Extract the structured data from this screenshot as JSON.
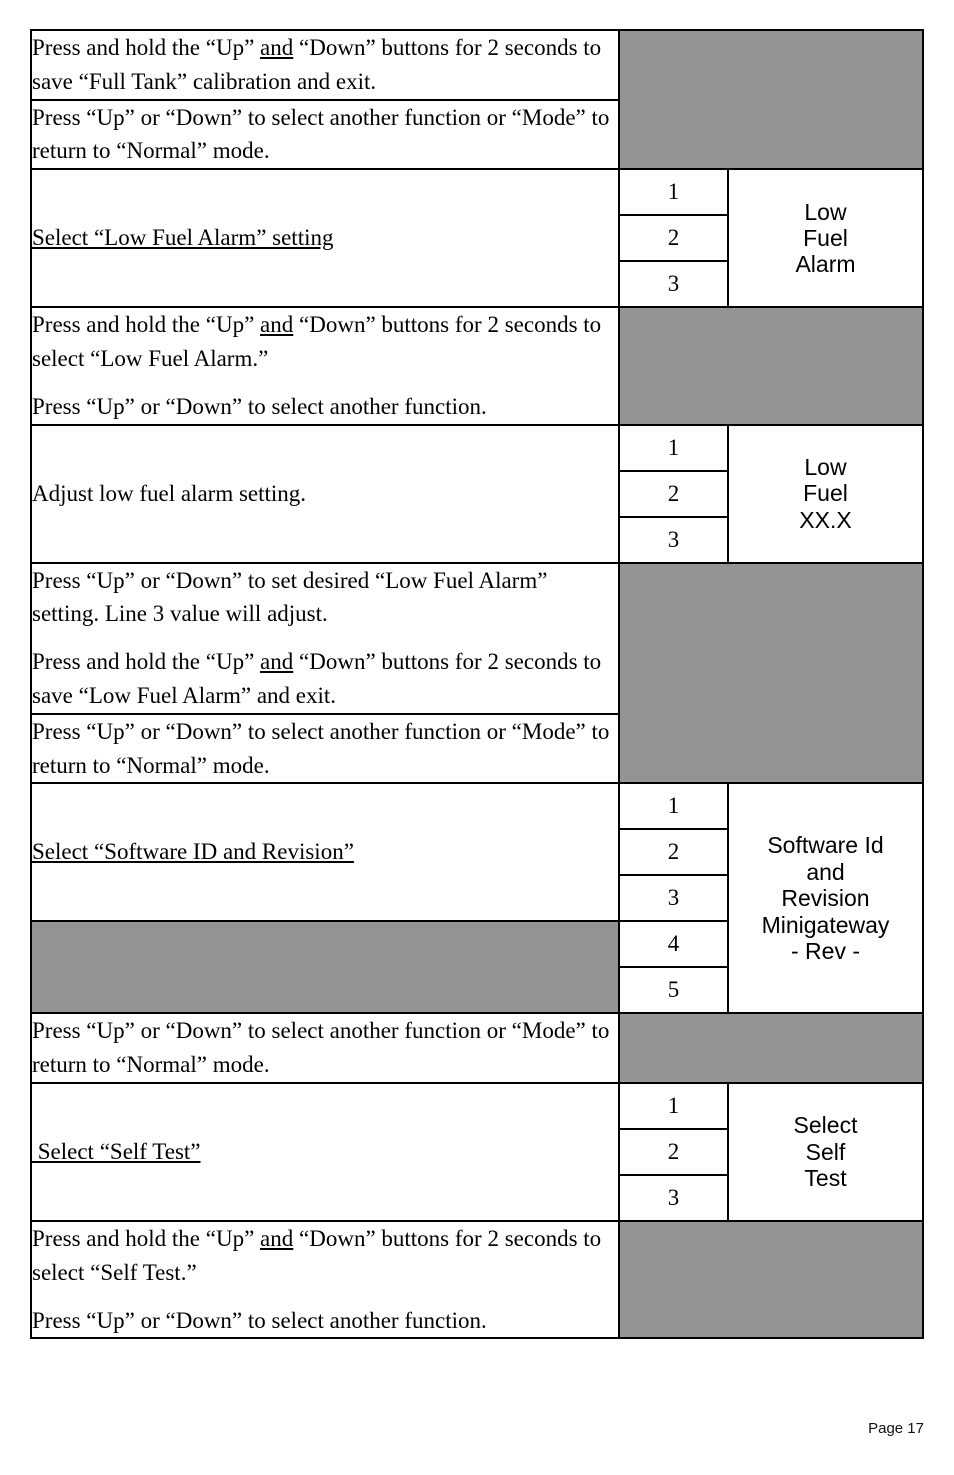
{
  "page": {
    "footer_label": "Page 17",
    "shade_color": "#949494",
    "border_color": "#000000"
  },
  "table": {
    "rows": [
      {
        "id": "save-full-tank",
        "instruction_paragraphs": [
          {
            "before": "Press and hold the “Up” ",
            "underlined": "and",
            "after": " “Down” buttons for 2 seconds to save “Full Tank” calibration and exit."
          }
        ]
      },
      {
        "id": "select-another-function-1",
        "instruction_paragraphs": [
          {
            "before": "Press “Up” or “Down” to select another function or “Mode” to return to “Normal” mode.",
            "underlined": "",
            "after": ""
          }
        ]
      },
      {
        "id": "select-low-fuel-alarm-setting",
        "heading": "Select “Low Fuel Alarm” setting",
        "numbers": [
          "1",
          "2",
          "3"
        ],
        "display_lines": [
          "Low",
          "Fuel",
          "Alarm"
        ]
      },
      {
        "id": "hold-to-select-low-fuel-alarm",
        "instruction_paragraphs": [
          {
            "before": "Press and hold the “Up” ",
            "underlined": "and",
            "after": " “Down” buttons for 2 seconds to select “Low Fuel Alarm.”"
          },
          {
            "before": "Press “Up” or “Down” to select another function.",
            "underlined": "",
            "after": ""
          }
        ]
      },
      {
        "id": "adjust-low-fuel-alarm-setting",
        "heading": "Adjust low fuel alarm setting.",
        "numbers": [
          "1",
          "2",
          "3"
        ],
        "display_lines": [
          "Low",
          "Fuel",
          "XX.X"
        ]
      },
      {
        "id": "set-desired-low-fuel-alarm",
        "instruction_paragraphs": [
          {
            "before": "Press “Up” or “Down” to set desired “Low Fuel Alarm” setting. Line 3 value will adjust.",
            "underlined": "",
            "after": ""
          },
          {
            "before": "Press and hold the “Up” ",
            "underlined": "and",
            "after": " “Down” buttons for 2 seconds to save “Low Fuel Alarm” and exit."
          }
        ]
      },
      {
        "id": "select-another-function-2",
        "instruction_paragraphs": [
          {
            "before": "Press “Up” or “Down” to select another function or “Mode” to return to “Normal” mode.",
            "underlined": "",
            "after": ""
          }
        ]
      },
      {
        "id": "select-software-id-and-revision",
        "heading": "Select “Software ID and Revision”",
        "numbers": [
          "1",
          "2",
          "3",
          "4",
          "5"
        ],
        "display_lines": [
          "Software Id",
          "and",
          "Revision",
          "Minigateway",
          "- Rev -"
        ]
      },
      {
        "id": "select-another-function-3",
        "instruction_paragraphs": [
          {
            "before": "Press “Up” or “Down” to select another function or “Mode” to return to “Normal” mode.",
            "underlined": "",
            "after": ""
          }
        ]
      },
      {
        "id": "select-self-test",
        "heading": " Select “Self Test”",
        "numbers": [
          "1",
          "2",
          "3"
        ],
        "display_lines": [
          "Select",
          "Self",
          "Test"
        ]
      },
      {
        "id": "hold-to-select-self-test",
        "instruction_paragraphs": [
          {
            "before": "Press and hold the “Up” ",
            "underlined": "and",
            "after": " “Down” buttons for 2 seconds to select “Self Test.”"
          },
          {
            "before": "Press “Up” or “Down” to select another function.",
            "underlined": "",
            "after": ""
          }
        ]
      }
    ]
  }
}
